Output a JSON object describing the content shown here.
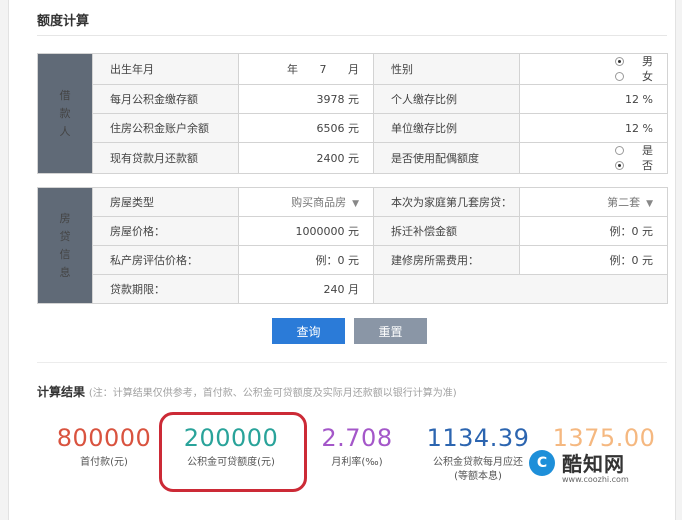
{
  "panel": {
    "title": "额度计算"
  },
  "borrower": {
    "section_label": "借款人",
    "birth": {
      "label": "出生年月",
      "year_unit": "年",
      "month": "7",
      "month_unit": "月"
    },
    "gender": {
      "label": "性别",
      "options": [
        "男",
        "女"
      ],
      "selected": "男"
    },
    "monthly_deposit": {
      "label": "每月公积金缴存额",
      "value": "3978",
      "unit": "元"
    },
    "personal_ratio": {
      "label": "个人缴存比例",
      "value": "12",
      "unit": "%"
    },
    "account_balance": {
      "label": "住房公积金账户余额",
      "value": "6506",
      "unit": "元"
    },
    "company_ratio": {
      "label": "单位缴存比例",
      "value": "12",
      "unit": "%"
    },
    "existing_loan": {
      "label": "现有贷款月还款额",
      "value": "2400",
      "unit": "元"
    },
    "spouse_quota": {
      "label": "是否使用配偶额度",
      "options": [
        "是",
        "否"
      ],
      "selected": "否"
    }
  },
  "house": {
    "section_label": "房贷信息",
    "house_type": {
      "label": "房屋类型",
      "value": "购买商品房"
    },
    "house_count": {
      "label": "本次为家庭第几套房贷：",
      "value": "第二套"
    },
    "price": {
      "label": "房屋价格：",
      "value": "1000000",
      "unit": "元"
    },
    "compensation": {
      "label": "拆迁补偿金额",
      "value": "例：0",
      "unit": "元"
    },
    "private_appraisal": {
      "label": "私产房评估价格：",
      "value": "例：0",
      "unit": "元"
    },
    "building_cost": {
      "label": "建修房所需费用：",
      "value": "例：0",
      "unit": "元"
    },
    "term": {
      "label": "贷款期限：",
      "value": "240",
      "unit": "月"
    }
  },
  "buttons": {
    "query": "查询",
    "reset": "重置"
  },
  "results": {
    "title": "计算结果",
    "note": "(注：计算结果仅供参考，首付款、公积金可贷额度及实际月还款额以银行计算为准)",
    "metrics": [
      {
        "value": "800000",
        "caption": "首付款(元)",
        "color": "#d9533f"
      },
      {
        "value": "200000",
        "caption": "公积金可贷额度(元)",
        "color": "#29a39a"
      },
      {
        "value": "2.708",
        "caption": "月利率(‰)",
        "color": "#a457c9"
      },
      {
        "value": "1134.39",
        "caption": "公积金贷款每月应还",
        "caption2": "(等额本息)",
        "color": "#2c65b0"
      },
      {
        "value": "1375.00",
        "caption": "",
        "color": "#ef8a2d"
      }
    ]
  },
  "watermark": {
    "name": "酷知网",
    "url": "www.coozhi.com",
    "logo_letter": "C",
    "color": "#1e8fd9"
  }
}
